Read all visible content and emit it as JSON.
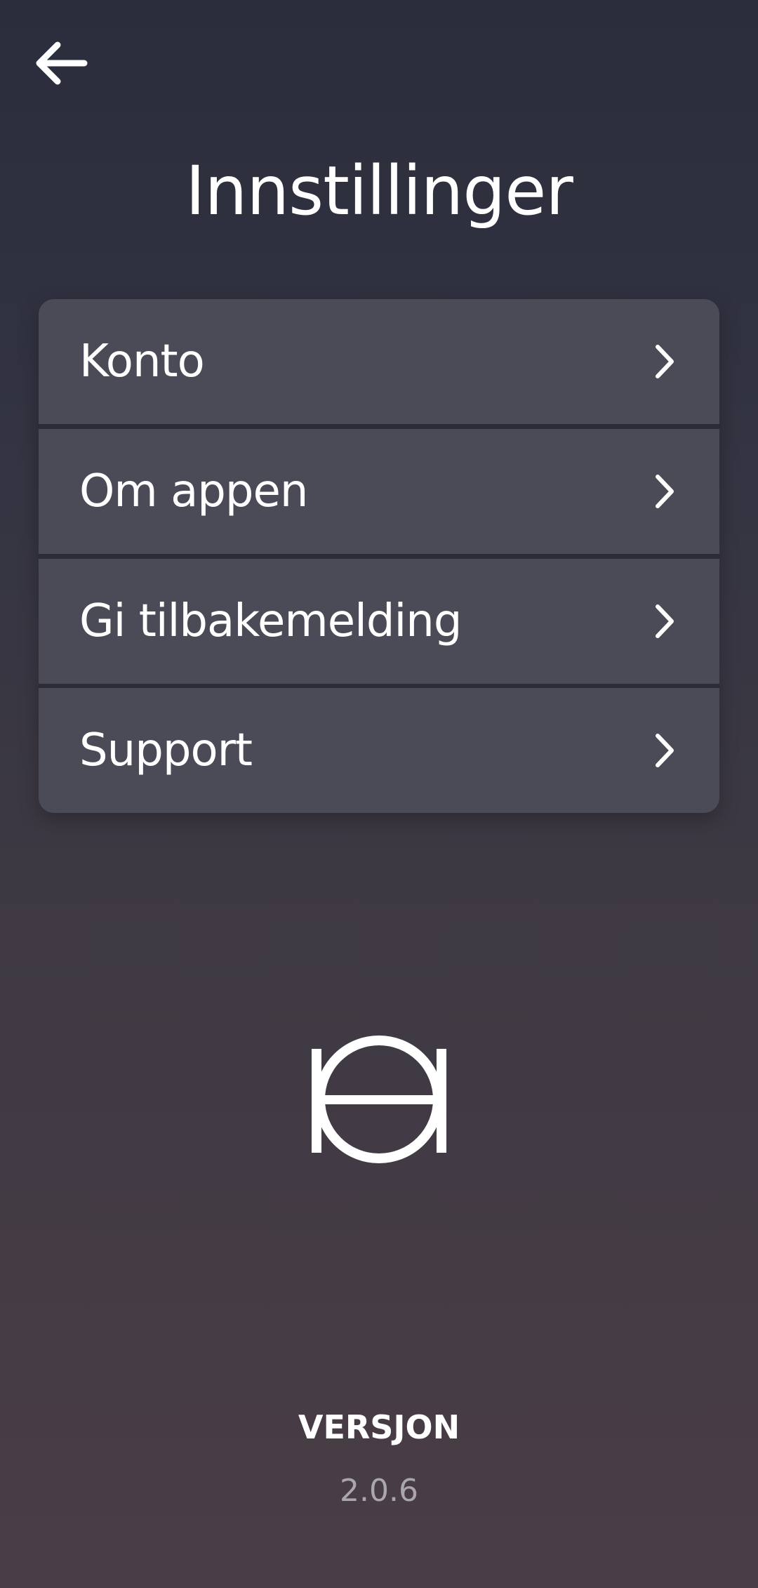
{
  "header": {
    "back_icon": "arrow-left-icon",
    "title": "Innstillinger"
  },
  "menu": {
    "items": [
      {
        "label": "Konto",
        "icon": "chevron-right-icon"
      },
      {
        "label": "Om appen",
        "icon": "chevron-right-icon"
      },
      {
        "label": "Gi tilbakemelding",
        "icon": "chevron-right-icon"
      },
      {
        "label": "Support",
        "icon": "chevron-right-icon"
      }
    ]
  },
  "footer": {
    "logo_icon": "brand-logo-icon",
    "version_label": "VERSJON",
    "version_value": "2.0.6"
  },
  "colors": {
    "background_top": "#2a2d3c",
    "background_bottom": "#4a3e46",
    "menu_item_bg": "#4b4b58",
    "text_primary": "#ffffff",
    "text_secondary": "#a9a6ae"
  }
}
